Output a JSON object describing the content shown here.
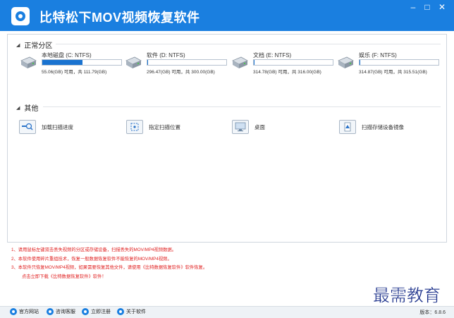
{
  "app": {
    "title": "比特松下MOV视频恢复软件"
  },
  "window_buttons": {
    "minimize": "–",
    "maximize": "□",
    "close": "✕"
  },
  "sections": {
    "partitions": "正常分区",
    "others": "其他"
  },
  "drives": [
    {
      "name": "本地磁盘 (C: NTFS)",
      "info": "55.06(GB) 可用，共 111.79(GB)",
      "used_fraction": 0.51
    },
    {
      "name": "软件 (D: NTFS)",
      "info": "296.47(GB) 可用，共 300.00(GB)",
      "used_fraction": 0.012
    },
    {
      "name": "文档 (E: NTFS)",
      "info": "314.78(GB) 可用，共 316.00(GB)",
      "used_fraction": 0.004
    },
    {
      "name": "娱乐 (F: NTFS)",
      "info": "314.87(GB) 可用，共 315.51(GB)",
      "used_fraction": 0.002
    }
  ],
  "others": [
    {
      "label": "加载扫描进度",
      "icon": "load-progress-icon"
    },
    {
      "label": "指定扫描位置",
      "icon": "target-location-icon"
    },
    {
      "label": "桌面",
      "icon": "desktop-icon"
    },
    {
      "label": "扫描存储设备镜像",
      "icon": "device-image-icon"
    }
  ],
  "notes": [
    "1、请用鼠标左键双击丢失视频的分区或存储设备，扫描丢失的MOV/MP4视频数据。",
    "2、本软件使用碎片重组技术，恢复一般数据恢复软件不能恢复的MOV/MP4视频。",
    "3、本软件只恢复MOV/MP4视频，如果需要恢复其他文件，请使用《比特数据恢复软件》软件恢复。",
    "点击立即下载《比特数据恢复软件》软件！"
  ],
  "watermark": "最需教育",
  "statusbar": {
    "items": [
      "官方网站",
      "咨询客服",
      "立即注册",
      "关于软件"
    ],
    "version": "版本：6.8.6"
  },
  "colors": {
    "accent": "#1a7fe0",
    "note_red": "#e01e1e"
  }
}
